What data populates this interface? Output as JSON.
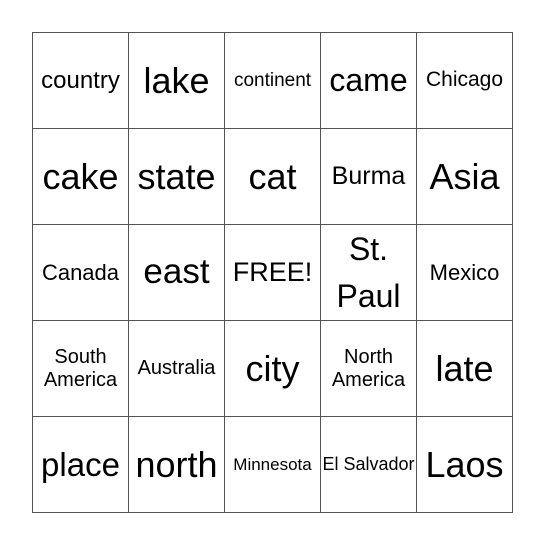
{
  "cells": [
    [
      "country",
      "lake",
      "continent",
      "came",
      "Chicago"
    ],
    [
      "cake",
      "state",
      "cat",
      "Burma",
      "Asia"
    ],
    [
      "Canada",
      "east",
      "FREE!",
      "St. Paul",
      "Mexico"
    ],
    [
      "South America",
      "Australia",
      "city",
      "North America",
      "late"
    ],
    [
      "place",
      "north",
      "Minnesota",
      "El Salvador",
      "Laos"
    ]
  ]
}
